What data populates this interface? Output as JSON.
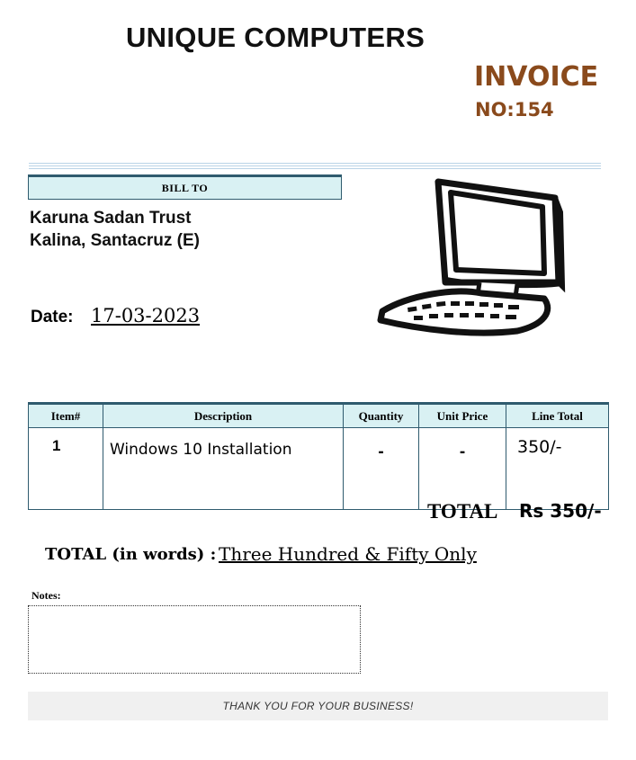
{
  "header": {
    "company_name": "UNIQUE COMPUTERS",
    "invoice_title": "INVOICE",
    "invoice_no_label": "NO:",
    "invoice_no": "154"
  },
  "bill_to": {
    "label": "BILL TO",
    "line1": "Karuna Sadan Trust",
    "line2": "Kalina, Santacruz (E)"
  },
  "date": {
    "label": "Date:",
    "value": "17-03-2023"
  },
  "table": {
    "headers": [
      "Item#",
      "Description",
      "Quantity",
      "Unit Price",
      "Line Total"
    ],
    "rows": [
      {
        "item": "1",
        "description": "Windows 10 Installation",
        "quantity": "-",
        "unit_price": "-",
        "line_total": "350/-"
      }
    ]
  },
  "totals": {
    "label": "TOTAL",
    "value": "Rs 350/-",
    "words_label": "TOTAL (in words) :",
    "words_value": "Three Hundred & Fifty Only"
  },
  "notes": {
    "label": "Notes:",
    "value": ""
  },
  "footer": {
    "thanks": "THANK YOU FOR YOUR BUSINESS!"
  },
  "images": {
    "computer": "computer-clipart-icon"
  },
  "colors": {
    "accent_brown": "#8a4a1c",
    "table_header_bg": "#d9f1f3",
    "border": "#2f5b6e"
  }
}
